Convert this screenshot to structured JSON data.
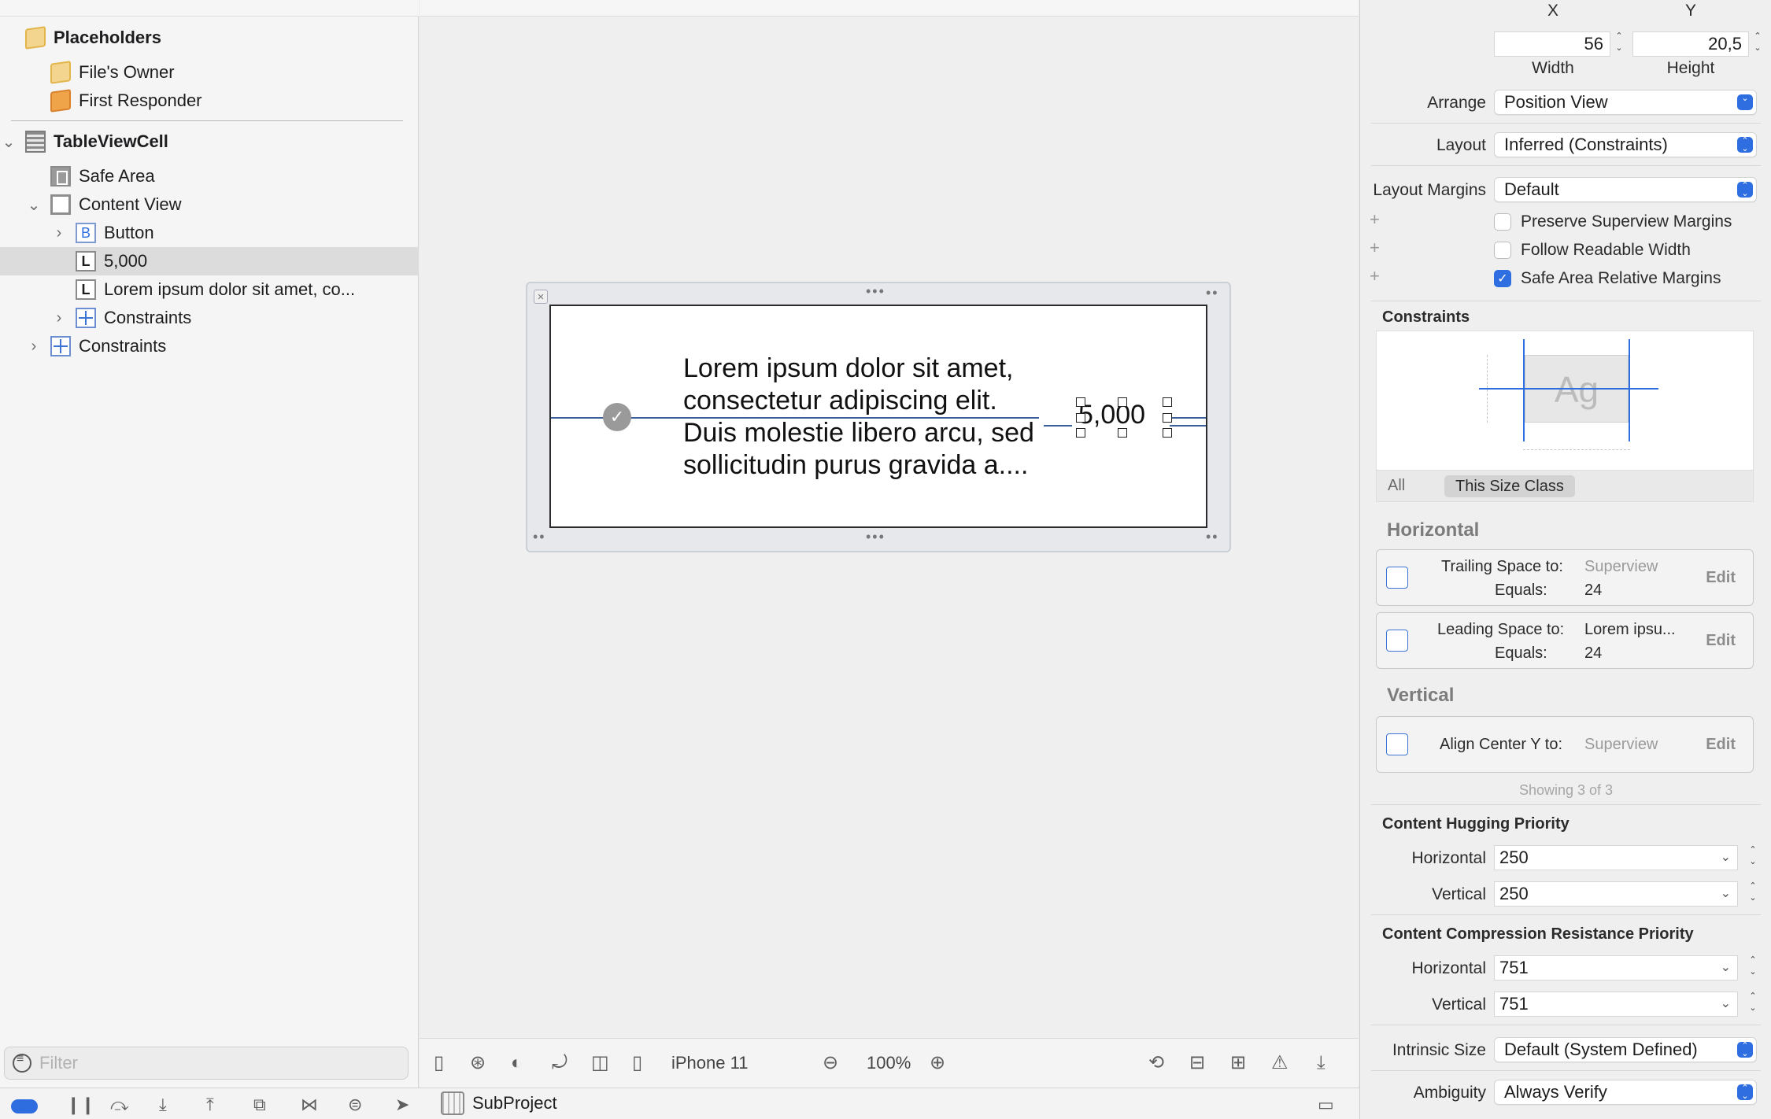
{
  "outline": {
    "items": [
      {
        "label": "Placeholders"
      },
      {
        "label": "File's Owner"
      },
      {
        "label": "First Responder"
      },
      {
        "label": "TableViewCell"
      },
      {
        "label": "Safe Area"
      },
      {
        "label": "Content View"
      },
      {
        "label": "Button",
        "icon_letter": "B"
      },
      {
        "label": "5,000",
        "icon_letter": "L"
      },
      {
        "label": "Lorem ipsum dolor sit amet, co...",
        "icon_letter": "L"
      },
      {
        "label": "Constraints"
      },
      {
        "label": "Constraints"
      }
    ],
    "selected_index": 7,
    "filter_placeholder": "Filter"
  },
  "canvas": {
    "cell_text": "Lorem ipsum dolor sit amet, consectetur adipiscing elit. Duis molestie libero arcu, sed sollicitudin purus gravida a....",
    "value_label": "5,000",
    "device": "iPhone 11",
    "zoom": "100%"
  },
  "bottombar": {
    "scheme": "SubProject"
  },
  "inspector": {
    "x_label": "X",
    "y_label": "Y",
    "width_value": "56",
    "height_value": "20,5",
    "width_label": "Width",
    "height_label": "Height",
    "arrange_label": "Arrange",
    "arrange_value": "Position View",
    "layout_label": "Layout",
    "layout_value": "Inferred (Constraints)",
    "margins_label": "Layout Margins",
    "margins_value": "Default",
    "preserve_label": "Preserve Superview Margins",
    "preserve_checked": false,
    "readable_label": "Follow Readable Width",
    "readable_checked": false,
    "safearea_label": "Safe Area Relative Margins",
    "safearea_checked": true,
    "constraints_label": "Constraints",
    "ag_label": "Ag",
    "sizeclass_all": "All",
    "sizeclass_this": "This Size Class",
    "horizontal_head": "Horizontal",
    "vertical_head": "Vertical",
    "constraints_list": [
      {
        "title": "Trailing Space to:",
        "target": "Superview",
        "equals_label": "Equals:",
        "equals": "24",
        "edit": "Edit"
      },
      {
        "title": "Leading Space to:",
        "target": "Lorem ipsu...",
        "equals_label": "Equals:",
        "equals": "24",
        "edit": "Edit"
      },
      {
        "title": "Align Center Y to:",
        "target": "Superview",
        "edit": "Edit"
      }
    ],
    "showing": "Showing 3 of 3",
    "hugging_head": "Content Hugging Priority",
    "hugging_h_label": "Horizontal",
    "hugging_h": "250",
    "hugging_v_label": "Vertical",
    "hugging_v": "250",
    "compression_head": "Content Compression Resistance Priority",
    "compression_h_label": "Horizontal",
    "compression_h": "751",
    "compression_v_label": "Vertical",
    "compression_v": "751",
    "intrinsic_label": "Intrinsic Size",
    "intrinsic_value": "Default (System Defined)",
    "ambiguity_label": "Ambiguity",
    "ambiguity_value": "Always Verify"
  },
  "colors": {
    "accent": "#2f6ee0",
    "constraint_line": "#3b5f9a"
  }
}
